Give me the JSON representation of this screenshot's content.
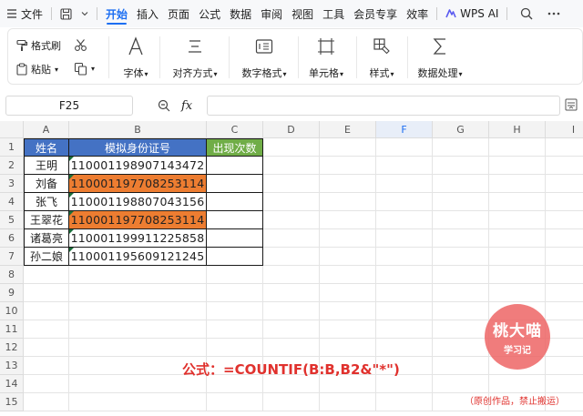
{
  "menubar": {
    "hamburger_label": "文件",
    "tabs": [
      "开始",
      "插入",
      "页面",
      "公式",
      "数据",
      "审阅",
      "视图",
      "工具",
      "会员专享",
      "效率"
    ],
    "active_tab": "开始",
    "ai_label": "WPS AI",
    "accent_color": "#1c6ef2"
  },
  "ribbon": {
    "format_painter": "格式刷",
    "paste": "粘贴",
    "font": "字体",
    "align": "对齐方式",
    "number_format": "数字格式",
    "cells": "单元格",
    "styles": "样式",
    "data_processing": "数据处理"
  },
  "formula_bar": {
    "name_box": "F25",
    "fx": "fx",
    "formula": ""
  },
  "sheet": {
    "columns": [
      "A",
      "B",
      "C",
      "D",
      "E",
      "F",
      "G",
      "H",
      "I"
    ],
    "selected_column": "F",
    "rows": [
      "1",
      "2",
      "3",
      "4",
      "5",
      "6",
      "7",
      "8",
      "9",
      "10",
      "11",
      "12",
      "13",
      "14",
      "15"
    ],
    "headers": {
      "a": "姓名",
      "b": "模拟身份证号",
      "c": "出现次数"
    },
    "header_colors": {
      "a": "#4472c4",
      "b": "#4472c4",
      "c": "#70ad47"
    },
    "highlight_color": "#ed7d31",
    "data": [
      {
        "name": "王明",
        "id": "110001198907143472",
        "highlight": false
      },
      {
        "name": "刘备",
        "id": "110001197708253114",
        "highlight": true
      },
      {
        "name": "张飞",
        "id": "110001198807043156",
        "highlight": false
      },
      {
        "name": "王翠花",
        "id": "110001197708253114",
        "highlight": true
      },
      {
        "name": "诸葛亮",
        "id": "110001199911225858",
        "highlight": false
      },
      {
        "name": "孙二娘",
        "id": "110001195609121245",
        "highlight": false
      }
    ]
  },
  "annotation": {
    "formula_text": "公式：=COUNTIF(B:B,B2&\"*\")",
    "color": "#e0312d"
  },
  "watermark": {
    "title": "桃大喵",
    "subtitle": "学习记",
    "notice": "（原创作品，禁止搬运）"
  }
}
